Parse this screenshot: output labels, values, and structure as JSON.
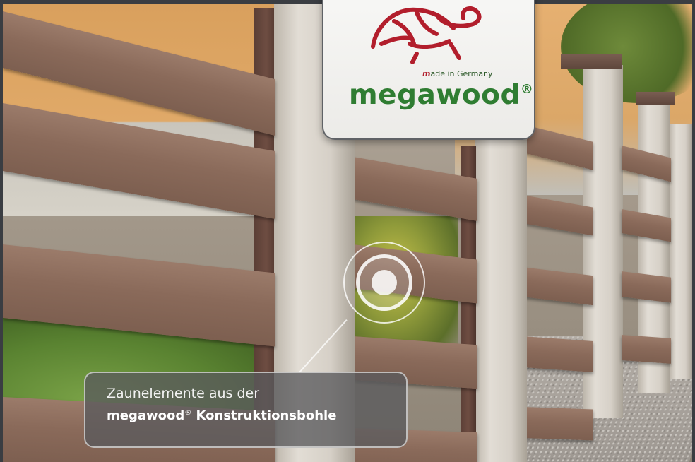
{
  "logo": {
    "made_in_prefix": "m",
    "made_in_text": "ade in Germany",
    "brand_name": "megawood",
    "brand_mark": "®",
    "icon": "turtle-logo-icon",
    "colors": {
      "green": "#2f7d32",
      "red": "#b21e2c"
    }
  },
  "hotspot": {
    "icon": "hotspot-target-icon"
  },
  "caption": {
    "line1": "Zaunelemente aus der",
    "line2_brand": "megawood",
    "line2_mark": "®",
    "line2_rest": " Konstruktionsbohle"
  }
}
